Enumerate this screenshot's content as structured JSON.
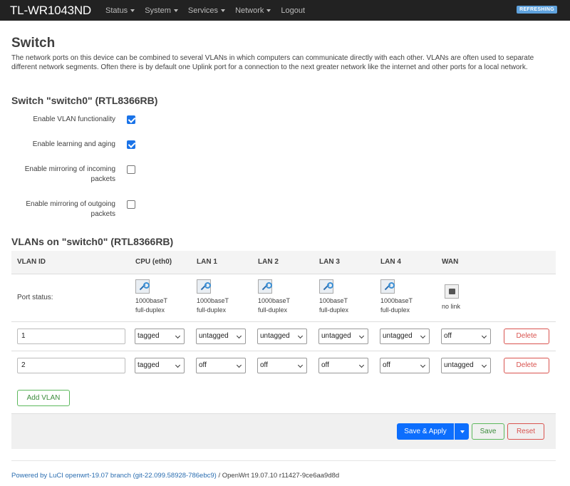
{
  "app": {
    "brand": "TL-WR1043ND",
    "refresh_badge": "REFRESHING"
  },
  "menu": [
    "Status",
    "System",
    "Services",
    "Network",
    "Logout"
  ],
  "page": {
    "title": "Switch",
    "description": "The network ports on this device can be combined to several VLANs in which computers can communicate directly with each other. VLANs are often used to separate different network segments. Often there is by default one Uplink port for a connection to the next greater network like the internet and other ports for a local network."
  },
  "switch_section": {
    "title": "Switch \"switch0\" (RTL8366RB)",
    "options": [
      {
        "label": "Enable VLAN functionality",
        "checked": true
      },
      {
        "label": "Enable learning and aging",
        "checked": true
      },
      {
        "label": "Enable mirroring of incoming packets",
        "checked": false
      },
      {
        "label": "Enable mirroring of outgoing packets",
        "checked": false
      }
    ]
  },
  "vlan_section": {
    "title": "VLANs on \"switch0\" (RTL8366RB)",
    "headers": [
      "VLAN ID",
      "CPU (eth0)",
      "LAN 1",
      "LAN 2",
      "LAN 3",
      "LAN 4",
      "WAN"
    ],
    "port_status_label": "Port status:",
    "port_status": [
      {
        "line1": "1000baseT",
        "line2": "full-duplex",
        "link": true
      },
      {
        "line1": "1000baseT",
        "line2": "full-duplex",
        "link": true
      },
      {
        "line1": "1000baseT",
        "line2": "full-duplex",
        "link": true
      },
      {
        "line1": "100baseT",
        "line2": "full-duplex",
        "link": true
      },
      {
        "line1": "1000baseT",
        "line2": "full-duplex",
        "link": true
      },
      {
        "line1": "no link",
        "line2": "",
        "link": false
      }
    ],
    "rows": [
      {
        "vlan_id": "1",
        "ports": [
          "tagged",
          "untagged",
          "untagged",
          "untagged",
          "untagged",
          "off"
        ]
      },
      {
        "vlan_id": "2",
        "ports": [
          "tagged",
          "off",
          "off",
          "off",
          "off",
          "untagged"
        ]
      }
    ],
    "delete_label": "Delete",
    "add_label": "Add VLAN"
  },
  "actions": {
    "save_apply": "Save & Apply",
    "save": "Save",
    "reset": "Reset"
  },
  "footer": {
    "link_text": "Powered by LuCI openwrt-19.07 branch (git-22.099.58928-786ebc9)",
    "rest": " / OpenWrt 19.07.10 r11427-9ce6aa9d8d"
  },
  "colors": {
    "primary": "#0d6efd",
    "danger": "#d9534f",
    "success": "#5cb85c",
    "topbar": "#222222"
  }
}
